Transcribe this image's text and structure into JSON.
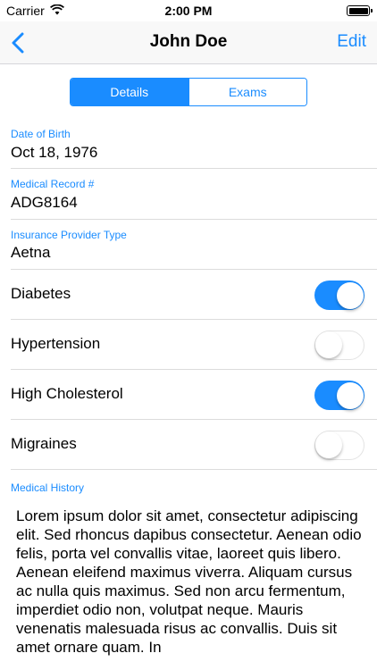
{
  "status_bar": {
    "carrier": "Carrier",
    "time": "2:00 PM"
  },
  "nav": {
    "title": "John Doe",
    "edit_label": "Edit"
  },
  "tabs": [
    {
      "label": "Details",
      "selected": true
    },
    {
      "label": "Exams",
      "selected": false
    }
  ],
  "fields": {
    "dob": {
      "label": "Date of Birth",
      "value": "Oct 18, 1976"
    },
    "mrn": {
      "label": "Medical Record #",
      "value": "ADG8164"
    },
    "insurance": {
      "label": "Insurance Provider Type",
      "value": "Aetna"
    }
  },
  "conditions": [
    {
      "label": "Diabetes",
      "on": true
    },
    {
      "label": "Hypertension",
      "on": false
    },
    {
      "label": "High Cholesterol",
      "on": true
    },
    {
      "label": "Migraines",
      "on": false
    }
  ],
  "history": {
    "label": "Medical History",
    "text": "Lorem ipsum dolor sit amet, consectetur adipiscing elit. Sed rhoncus dapibus consectetur. Aenean odio felis, porta vel convallis vitae, laoreet quis libero. Aenean eleifend maximus viverra. Aliquam cursus ac nulla quis maximus. Sed non arcu fermentum, imperdiet odio non, volutpat neque. Mauris venenatis malesuada risus ac convallis. Duis sit amet ornare quam. In"
  },
  "colors": {
    "accent": "#1a8cff",
    "switch_off_border": "#e3e3e3"
  }
}
